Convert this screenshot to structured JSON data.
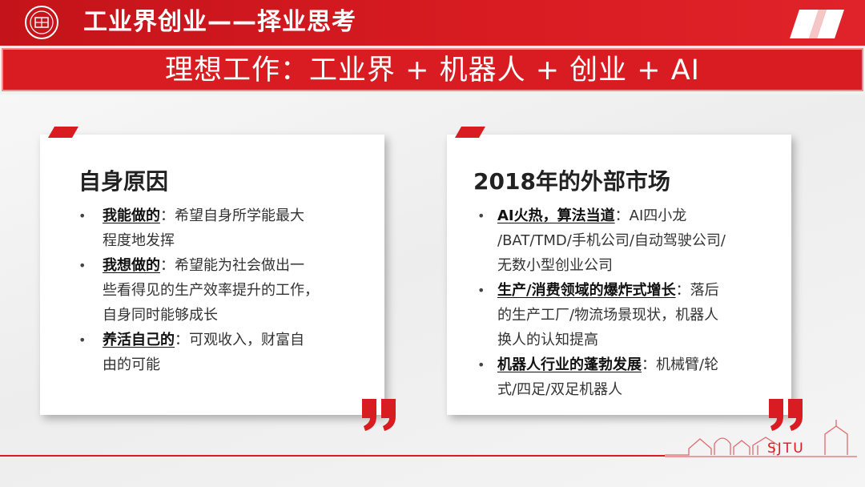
{
  "header": {
    "title": "工业界创业——择业思考",
    "accent_color": "#d91c22"
  },
  "banner": {
    "text": "理想工作：工业界 + 机器人 + 创业 + AI"
  },
  "left_card": {
    "title": "自身原因",
    "bullets": [
      {
        "bold": "我能做的",
        "lines": [
          "：希望自身所学能最大",
          "程度地发挥"
        ]
      },
      {
        "bold": "我想做的",
        "lines": [
          "：希望能为社会做出一",
          "些看得见的生产效率提升的工作，",
          "自身同时能够成长"
        ]
      },
      {
        "bold": "养活自己的",
        "lines": [
          "：可观收入，财富自",
          "由的可能"
        ]
      }
    ]
  },
  "right_card": {
    "title": "2018年的外部市场",
    "bullets": [
      {
        "bold": "AI火热，算法当道",
        "lines": [
          "：AI四小龙",
          "/BAT/TMD/手机公司/自动驾驶公司/",
          "无数小型创业公司"
        ]
      },
      {
        "bold": "生产/消费领域的爆炸式增长",
        "lines": [
          "：落后",
          "的生产工厂/物流场景现状，机器人",
          "换人的认知提高"
        ]
      },
      {
        "bold": "机器人行业的蓬勃发展",
        "lines": [
          "：机械臂/轮",
          "式/四足/双足机器人"
        ]
      }
    ]
  },
  "footer": {
    "brand_text": "SJTU"
  },
  "icons": {
    "logo": "university-seal-icon",
    "quote": "closing-quote-icon",
    "skyline": "campus-skyline-icon"
  }
}
